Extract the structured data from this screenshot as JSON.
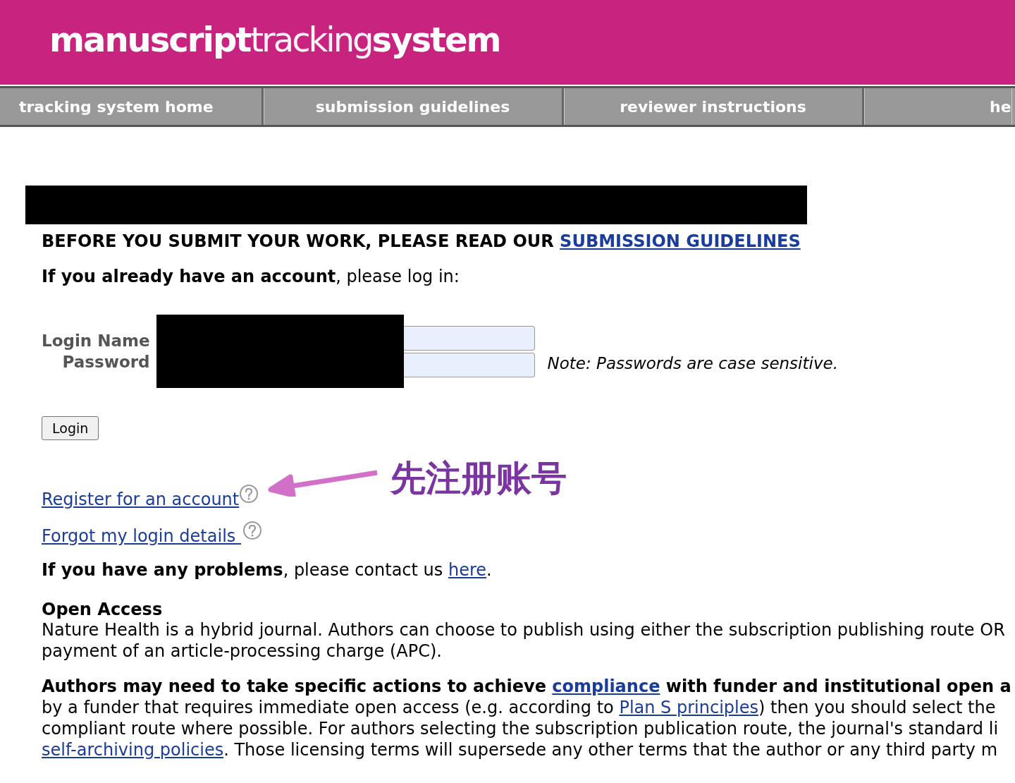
{
  "header": {
    "logo": [
      {
        "text": "manuscript",
        "kind": "bold"
      },
      {
        "text": "tracking",
        "kind": "light"
      },
      {
        "text": "system",
        "kind": "bold"
      }
    ]
  },
  "nav": [
    {
      "label": "tracking system home"
    },
    {
      "label": "submission guidelines"
    },
    {
      "label": "reviewer instructions"
    },
    {
      "label": "he"
    }
  ],
  "title_bar": {
    "redacted": true
  },
  "notice": [
    {
      "kind": "bold",
      "text": "BEFORE YOU SUBMIT YOUR WORK, PLEASE READ OUR "
    },
    {
      "kind": "bold_link",
      "text": "SUBMISSION GUIDELINES"
    }
  ],
  "login_prompt": [
    {
      "kind": "bold",
      "text": "If you already have an account"
    },
    {
      "kind": "text",
      "text": ", please log in:"
    }
  ],
  "login_form": {
    "fields": [
      {
        "label": "Login Name"
      },
      {
        "label": "Password"
      }
    ],
    "redacted": true,
    "note": "Note: Passwords are case sensitive.",
    "button": "Login"
  },
  "links": [
    {
      "label": "Register for an account",
      "help": true
    },
    {
      "label": "Forgot my login details ",
      "help": true
    }
  ],
  "annotation": {
    "text": "先注册账号"
  },
  "contact": [
    {
      "kind": "bold",
      "text": "If you have any problems"
    },
    {
      "kind": "text",
      "text": ", please contact us "
    },
    {
      "kind": "link",
      "text": "here"
    },
    {
      "kind": "text",
      "text": "."
    }
  ],
  "open_access": {
    "heading": "Open Access",
    "lines": [
      [
        {
          "kind": "text",
          "text": "Nature Health is a hybrid journal. Authors can choose to publish using either the subscription publishing route OR"
        }
      ],
      [
        {
          "kind": "text",
          "text": "payment of an article-processing charge (APC)."
        }
      ]
    ]
  },
  "compliance": {
    "lines": [
      [
        {
          "kind": "bold",
          "text": "Authors may need to take specific actions to achieve "
        },
        {
          "kind": "bold_link",
          "text": "compliance"
        },
        {
          "kind": "bold",
          "text": " with funder and institutional open a"
        }
      ],
      [
        {
          "kind": "text",
          "text": "by a funder that requires immediate open access (e.g. according to "
        },
        {
          "kind": "link",
          "text": "Plan S principles"
        },
        {
          "kind": "text",
          "text": ") then you should select the"
        }
      ],
      [
        {
          "kind": "text",
          "text": "compliant route where possible. For authors selecting the subscription publication route, the journal's standard li"
        }
      ],
      [
        {
          "kind": "link",
          "text": "self-archiving policies"
        },
        {
          "kind": "text",
          "text": ". Those licensing terms will supersede any other terms that the author or any third party m"
        }
      ]
    ]
  }
}
